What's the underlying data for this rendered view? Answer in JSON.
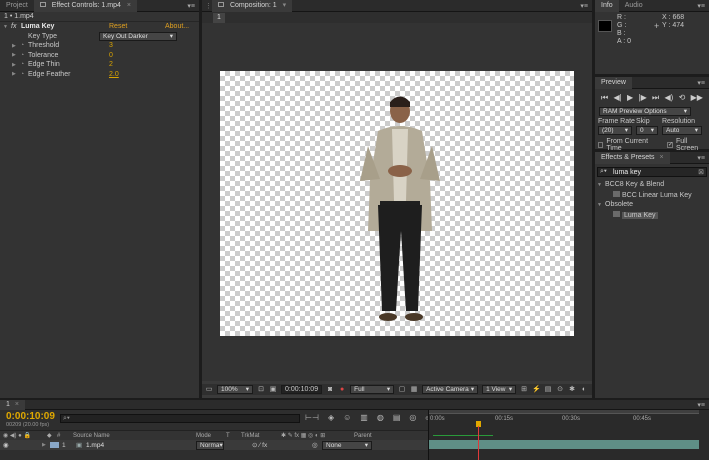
{
  "project_tab": "Project",
  "effect_controls_tab": "Effect Controls: 1.mp4",
  "layer_path": "1 • 1.mp4",
  "effect": {
    "fx": "fx",
    "name": "Luma Key",
    "reset": "Reset",
    "about": "About...",
    "params": [
      {
        "label": "Key Type",
        "value": "Key Out Darker"
      },
      {
        "label": "Threshold",
        "value": "3"
      },
      {
        "label": "Tolerance",
        "value": "0"
      },
      {
        "label": "Edge Thin",
        "value": "2"
      },
      {
        "label": "Edge Feather",
        "value": "2.0"
      }
    ]
  },
  "composition": {
    "tab": "Composition: 1",
    "subtab": "1",
    "footer": {
      "zoom": "100%",
      "timecode": "0:00:10:09",
      "resolution": "Full",
      "camera": "Active Camera",
      "views": "1 View"
    }
  },
  "info": {
    "tab": "Info",
    "audio_tab": "Audio",
    "r": "R :",
    "g": "G :",
    "b": "B :",
    "a": "A : 0",
    "x": "X : 668",
    "y": "Y : 474"
  },
  "preview": {
    "tab": "Preview",
    "ram_options": "RAM Preview Options",
    "frame_rate_label": "Frame Rate",
    "skip_label": "Skip",
    "resolution_label": "Resolution",
    "frame_rate": "(20)",
    "skip": "0",
    "resolution": "Auto",
    "from_current": "From Current Time",
    "full_screen": "Full Screen"
  },
  "effects_presets": {
    "tab": "Effects & Presets",
    "search": "luma key",
    "groups": [
      {
        "name": "BCC8 Key & Blend",
        "items": [
          "BCC Linear Luma Key"
        ]
      },
      {
        "name": "Obsolete",
        "items": [
          "Luma Key"
        ]
      }
    ]
  },
  "timeline": {
    "tab": "1",
    "timecode": "0:00:10:09",
    "frame_info": "00209 (20.00 fps)",
    "columns": {
      "source": "Source Name",
      "mode": "Mode",
      "t": "T",
      "trkmat": "TrkMat",
      "parent": "Parent"
    },
    "layer": {
      "num": "1",
      "name": "1.mp4",
      "mode": "Norma",
      "parent": "None"
    },
    "ruler": [
      "0:00s",
      "00:15s",
      "00:30s",
      "00:45s"
    ]
  },
  "colors": {
    "accent": "#d9a300",
    "layer_bar": "#5f8f86",
    "playhead": "#e03a3a"
  }
}
